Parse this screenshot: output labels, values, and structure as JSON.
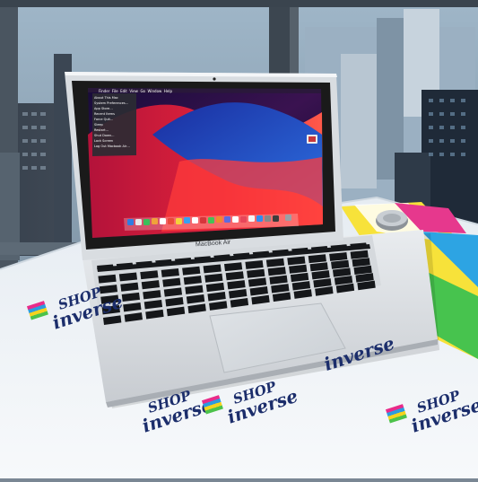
{
  "photo": {
    "laptop_bezel_label": "MacBook Air",
    "menubar": {
      "items": [
        "Finder",
        "File",
        "Edit",
        "View",
        "Go",
        "Window",
        "Help"
      ]
    },
    "apple_menu": {
      "items": [
        "About This Mac",
        "System Preferences…",
        "App Store…",
        "Recent Items",
        "Force Quit…",
        "Sleep",
        "Restart…",
        "Shut Down…",
        "Lock Screen",
        "Log Out Macbook Air…"
      ]
    },
    "watermark": {
      "line1": "SHOP",
      "line2": "inverse"
    }
  }
}
